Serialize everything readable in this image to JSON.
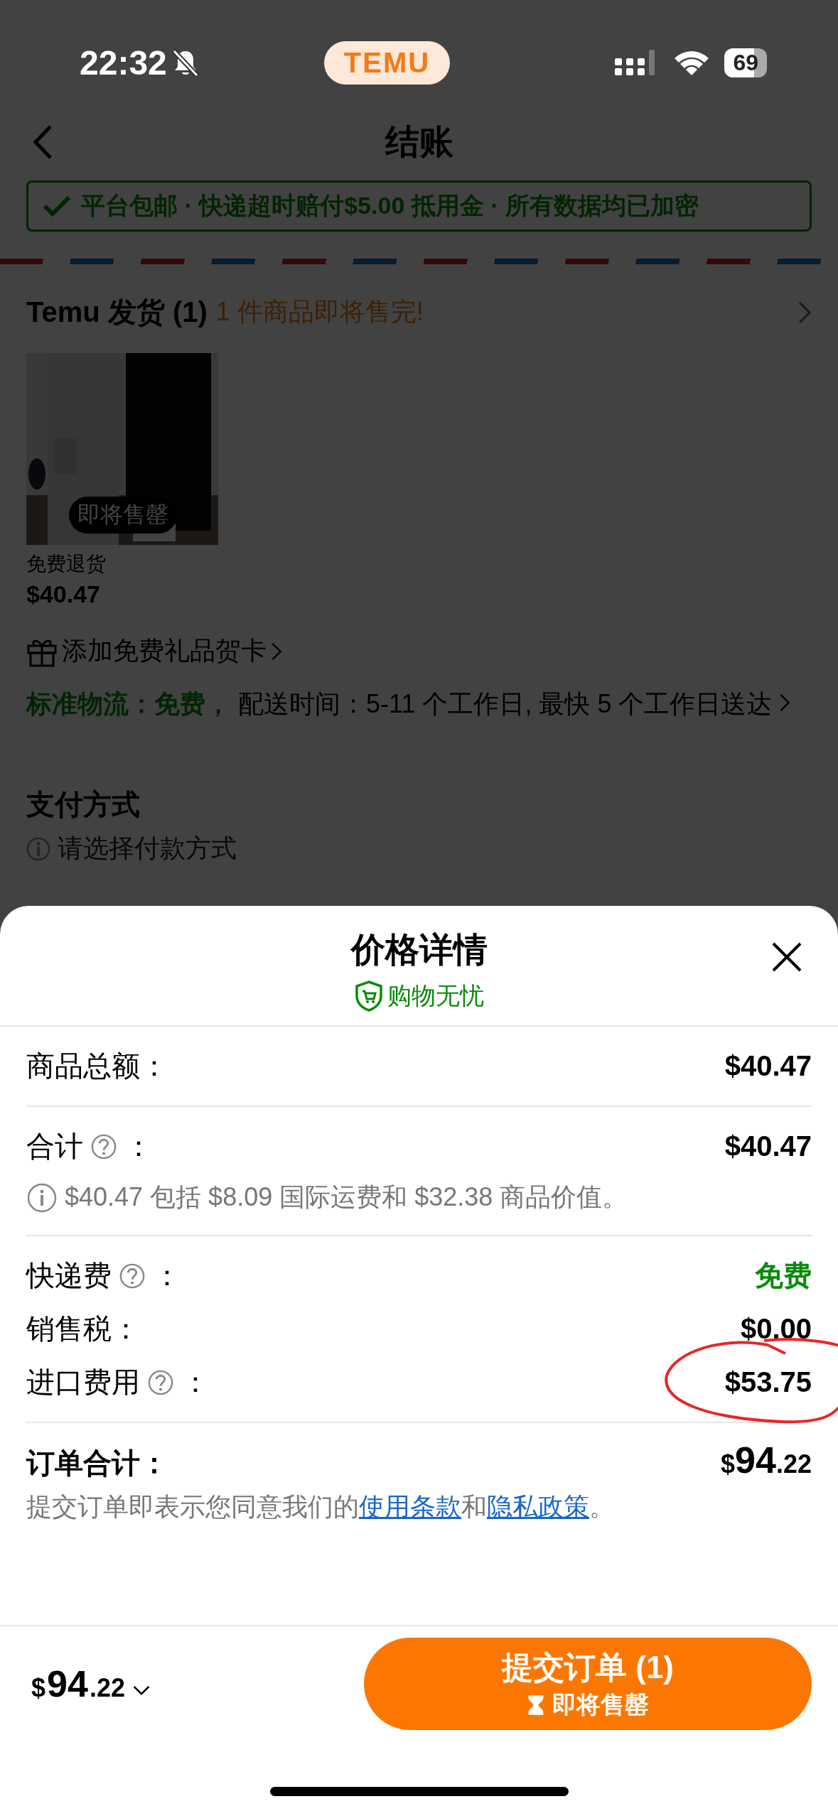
{
  "status_bar": {
    "time": "22:32",
    "silenced": true,
    "app_badge": "TEMU",
    "battery": "69"
  },
  "nav": {
    "title": "结账"
  },
  "banner": {
    "text": "平台包邮 · 快递超时赔付$5.00 抵用金 · 所有数据均已加密"
  },
  "shipment": {
    "title": "Temu 发货 (1)",
    "notice": "1 件商品即将售完!",
    "item": {
      "kind": "picture",
      "badge": "即将售罄",
      "return_note": "免费退货",
      "price": "$40.47"
    },
    "gift_card": "添加免费礼品贺卡",
    "shipping_label": "标准物流：免费，",
    "shipping_detail": "配送时间：5-11 个工作日, 最快 5 个工作日送达"
  },
  "payment": {
    "title": "支付方式",
    "hint": "请选择付款方式"
  },
  "sheet": {
    "title": "价格详情",
    "subtitle": "购物无忧",
    "sections": [
      {
        "rows": [
          {
            "label": "商品总额：",
            "help": false,
            "value": "$40.47",
            "kind": "amount",
            "circled": false
          }
        ]
      },
      {
        "rows": [
          {
            "label": "合计",
            "help": true,
            "after_help": "：",
            "value": "$40.47",
            "kind": "amount",
            "circled": false
          }
        ],
        "note": "$40.47 包括 $8.09 国际运费和 $32.38 商品价值。"
      },
      {
        "rows": [
          {
            "label": "快递费",
            "help": true,
            "after_help": "：",
            "value": "免费",
            "kind": "free",
            "circled": false
          },
          {
            "label": "销售税：",
            "help": false,
            "value": "$0.00",
            "kind": "amount",
            "circled": false
          },
          {
            "label": "进口费用",
            "help": true,
            "after_help": "：",
            "value": "$53.75",
            "kind": "amount",
            "circled": true
          }
        ]
      }
    ],
    "total": {
      "label": "订单合计：",
      "currency": "$",
      "whole": "94",
      "cents": ".22"
    },
    "legal": [
      {
        "kind": "text",
        "text": "提交订单即表示您同意我们的"
      },
      {
        "kind": "link",
        "text": "使用条款"
      },
      {
        "kind": "text",
        "text": "和"
      },
      {
        "kind": "link",
        "text": "隐私政策"
      },
      {
        "kind": "text",
        "text": "。"
      }
    ]
  },
  "bottom_bar": {
    "currency": "$",
    "whole": "94",
    "cents": ".22",
    "submit": "提交订单 (1)",
    "submit_note": "即将售罄"
  }
}
